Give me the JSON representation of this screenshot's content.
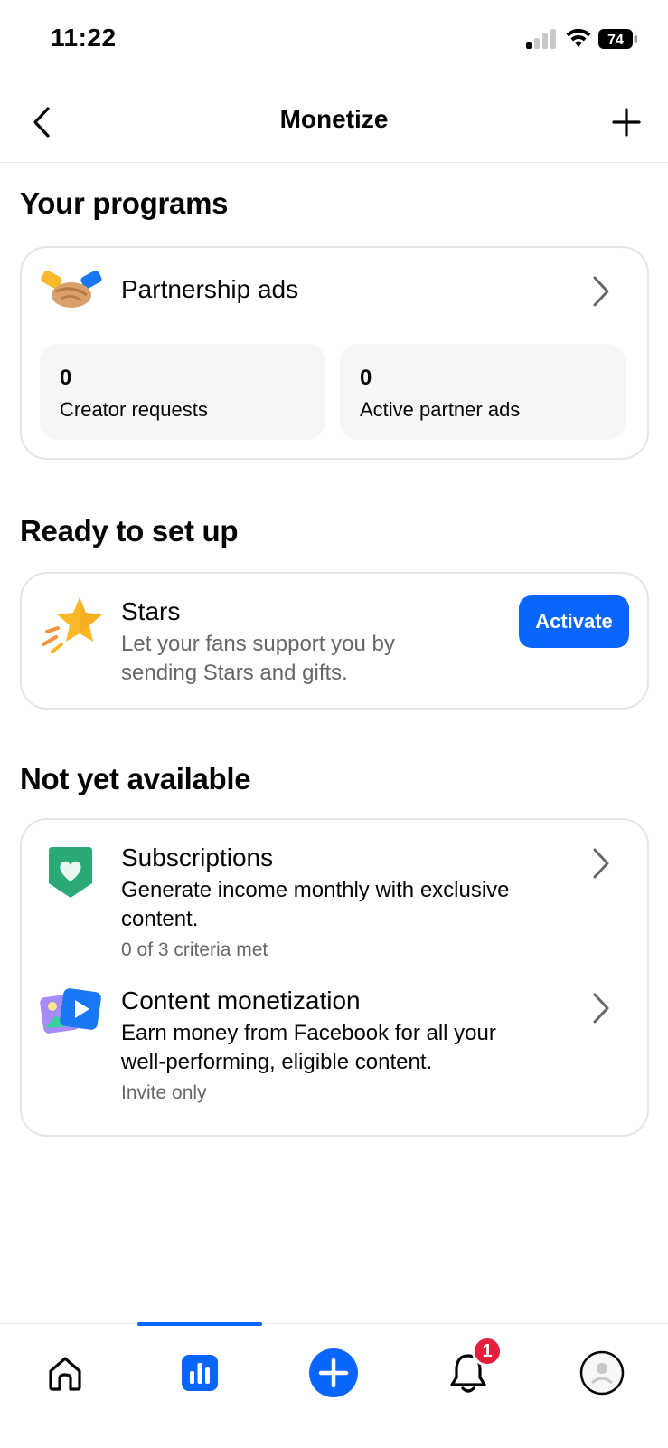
{
  "status_bar": {
    "time": "11:22",
    "battery": "74"
  },
  "header": {
    "title": "Monetize",
    "back_icon": "chevron-left-icon",
    "add_icon": "plus-icon"
  },
  "your_programs": {
    "title": "Your programs",
    "partnership": {
      "label": "Partnership ads",
      "icon": "handshake-icon",
      "stats": [
        {
          "value": "0",
          "label": "Creator requests"
        },
        {
          "value": "0",
          "label": "Active partner ads"
        }
      ]
    }
  },
  "ready": {
    "title": "Ready to set up",
    "stars": {
      "title": "Stars",
      "description_line1": "Let your fans support you by",
      "description_line2": "sending Stars and gifts.",
      "button": "Activate",
      "icon": "star-icon"
    }
  },
  "not_available": {
    "title": "Not yet available",
    "items": [
      {
        "title": "Subscriptions",
        "desc_line1": "Generate income monthly with exclusive",
        "desc_line2": "content.",
        "meta": "0 of 3 criteria met",
        "icon": "heart-badge-icon"
      },
      {
        "title": "Content monetization",
        "desc_line1": "Earn money from Facebook for all your",
        "desc_line2": "well-performing, eligible content.",
        "meta": "Invite only",
        "icon": "media-icon"
      }
    ]
  },
  "bottom_nav": {
    "items": [
      "home-icon",
      "insights-icon",
      "create-icon",
      "notifications-icon",
      "profile-icon"
    ],
    "notification_count": "1",
    "accent": "#0866ff"
  }
}
